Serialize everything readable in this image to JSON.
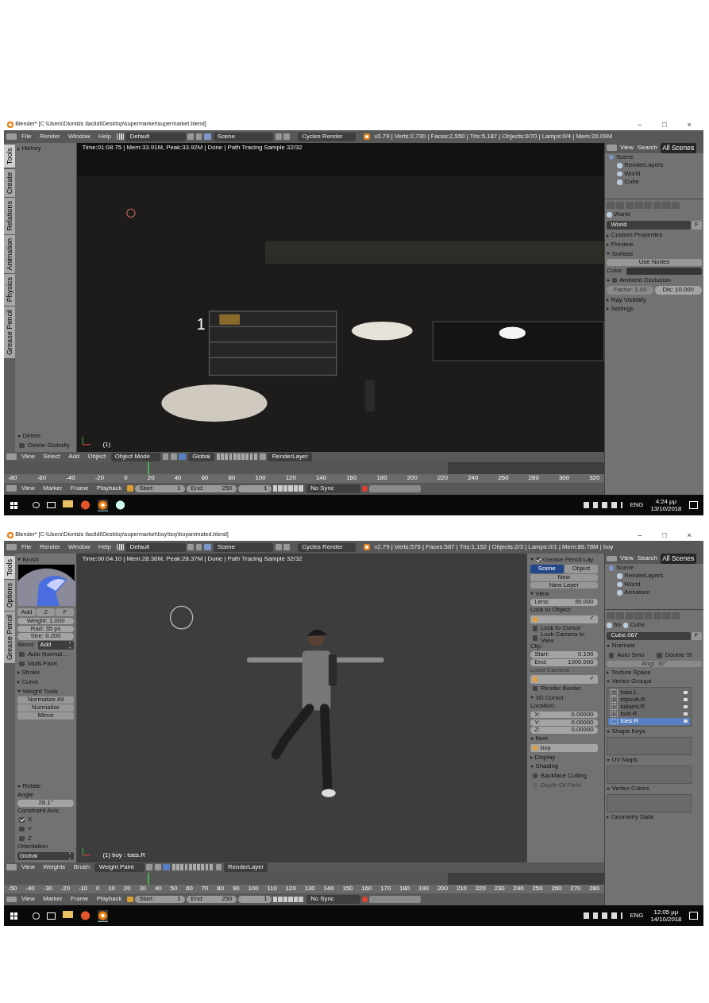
{
  "shots": [
    {
      "title": "Blender* [C:\\Users\\Dionisis Ilaclidi\\Desktop\\supermarket\\supermarket.blend]",
      "window_controls": [
        "–",
        "□",
        "×"
      ],
      "menus": [
        "File",
        "Render",
        "Window",
        "Help"
      ],
      "layout": "Default",
      "scene": "Scene",
      "engine": "Cycles Render",
      "stats": "v2.79 | Verts:2,730 | Faces:2,550 | Tris:5,187 | Objects:0/70 | Lamps:0/4 | Mem:20.09M",
      "tool_tabs": [
        {
          "label": "Tools",
          "selected": true
        },
        {
          "label": "Create",
          "selected": false
        },
        {
          "label": "Relations",
          "selected": false
        },
        {
          "label": "Animation",
          "selected": false
        },
        {
          "label": "Physics",
          "selected": false
        },
        {
          "label": "Grease Pencil",
          "selected": false
        }
      ],
      "tool_panels": [
        {
          "kind": "panel",
          "label": "History",
          "expanded": false
        }
      ],
      "tool_panels_lower": [
        {
          "kind": "panel",
          "label": "Delete",
          "expanded": true
        },
        {
          "kind": "check",
          "label": "Delete Globally",
          "checked": false
        }
      ],
      "render_info": "Time:01:08.75 | Mem:33.91M, Peak:33.92M | Done | Path Tracing Sample 32/32",
      "viewport": {
        "kind": "render",
        "marker": "1",
        "label": "(1)"
      },
      "viewport_header": {
        "menus": [
          "View",
          "Select",
          "Add",
          "Object"
        ],
        "mode": "Object Mode",
        "orientation": "Global",
        "layer": "RenderLayer"
      },
      "ruler": [
        "-80",
        "-60",
        "-40",
        "-20",
        "0",
        "20",
        "40",
        "60",
        "80",
        "100",
        "120",
        "140",
        "160",
        "180",
        "200",
        "220",
        "240",
        "260",
        "280",
        "300",
        "320"
      ],
      "timeline": {
        "menus": [
          "View",
          "Marker",
          "Frame",
          "Playback"
        ],
        "start_label": "Start:",
        "start": "1",
        "end_label": "End:",
        "end": "250",
        "frame": "1",
        "sync": "No Sync"
      },
      "outliner": {
        "menus": [
          "View",
          "Search"
        ],
        "filter": "All Scenes",
        "tree": [
          {
            "label": "Scene",
            "children": [
              {
                "label": "RenderLayers"
              },
              {
                "label": "World"
              },
              {
                "label": "Cube"
              }
            ]
          }
        ]
      },
      "properties": {
        "path": [
          "World"
        ],
        "datablock": "World",
        "datablock_flag": "F",
        "widgets": [
          {
            "kind": "panel",
            "label": "Custom Properties",
            "expanded": false
          },
          {
            "kind": "panel",
            "label": "Preview",
            "expanded": false
          },
          {
            "kind": "panel",
            "label": "Surface",
            "expanded": true
          },
          {
            "kind": "button",
            "label": "Use Nodes"
          },
          {
            "kind": "color",
            "label": "Color:"
          },
          {
            "kind": "panel",
            "label": "Ambient Occlusion",
            "expanded": true,
            "checked": false
          },
          {
            "kind": "pair",
            "items": [
              {
                "kind": "field",
                "label": "Factor: 1.00",
                "disabled": true
              },
              {
                "kind": "field",
                "label": "Dis: 10.000",
                "disabled": false
              }
            ]
          },
          {
            "kind": "panel",
            "label": "Ray Visibility",
            "expanded": false
          },
          {
            "kind": "panel",
            "label": "Settings",
            "expanded": false
          }
        ]
      },
      "taskbar": {
        "apps": [
          {
            "kind": "folder",
            "selected": false
          },
          {
            "kind": "browser",
            "selected": false
          },
          {
            "kind": "blender",
            "selected": true
          },
          {
            "kind": "program",
            "selected": false
          }
        ],
        "lang": "ENG",
        "time": "4:24 μμ",
        "date": "13/10/2018"
      }
    },
    {
      "title": "Blender* [C:\\Users\\Dionisis Ilaclidi\\Desktop\\supermarket\\boy\\boy\\boyanimated.blend]",
      "window_controls": [
        "–",
        "□",
        "×"
      ],
      "menus": [
        "File",
        "Render",
        "Window",
        "Help"
      ],
      "layout": "Default",
      "scene": "Scene",
      "engine": "Cycles Render",
      "stats": "v2.79 | Verts:575 | Faces:587 | Tris:1,152 | Objects:2/3 | Lamps:0/1 | Mem:86.78M | boy",
      "tool_tabs": [
        {
          "label": "Tools",
          "selected": true
        },
        {
          "label": "Options",
          "selected": false
        },
        {
          "label": "Grease Pencil",
          "selected": false
        }
      ],
      "tool_panels": [
        {
          "kind": "panel",
          "label": "Brush",
          "expanded": true
        },
        {
          "kind": "brush"
        },
        {
          "kind": "pair",
          "items": [
            {
              "kind": "button",
              "label": "Add"
            },
            {
              "kind": "button",
              "label": "2"
            },
            {
              "kind": "button",
              "label": "F"
            }
          ]
        },
        {
          "kind": "field",
          "label": "Weight: 1.000"
        },
        {
          "kind": "field",
          "label": "Rad: 35 px"
        },
        {
          "kind": "field",
          "label": "Stre: 0.200"
        },
        {
          "kind": "select",
          "label": "Blend:",
          "value": "Add"
        },
        {
          "kind": "check",
          "label": "Auto Normal...",
          "checked": false
        },
        {
          "kind": "check",
          "label": "Multi-Paint",
          "checked": false
        },
        {
          "kind": "panel",
          "label": "Stroke",
          "expanded": false
        },
        {
          "kind": "panel",
          "label": "Curve",
          "expanded": false
        },
        {
          "kind": "panel",
          "label": "Weight Tools",
          "expanded": true
        },
        {
          "kind": "button",
          "label": "Normalize All"
        },
        {
          "kind": "button",
          "label": "Normalize"
        },
        {
          "kind": "button",
          "label": "Mirror"
        }
      ],
      "tool_panels_lower": [
        {
          "kind": "panel",
          "label": "Rotate",
          "expanded": true
        },
        {
          "kind": "label",
          "label": "Angle"
        },
        {
          "kind": "field",
          "label": "28.1°"
        },
        {
          "kind": "label",
          "label": "Constraint Axis:"
        },
        {
          "kind": "check",
          "label": "X",
          "checked": true
        },
        {
          "kind": "check",
          "label": "Y",
          "checked": false
        },
        {
          "kind": "check",
          "label": "Z",
          "checked": false
        },
        {
          "kind": "label",
          "label": "Orientation"
        },
        {
          "kind": "select",
          "value": "Global"
        }
      ],
      "render_info": "Time:00:04.10 | Mem:28.36M, Peak:28.37M | Done | Path Tracing Sample 32/32",
      "viewport": {
        "kind": "character",
        "label": "(1) boy : toes.R"
      },
      "npanel": [
        {
          "kind": "panel",
          "label": "Grease Pencil Lay",
          "expanded": true,
          "checked": true
        },
        {
          "kind": "pair",
          "items": [
            {
              "kind": "button",
              "label": "Scene",
              "selected": true
            },
            {
              "kind": "button",
              "label": "Object",
              "selected": false
            }
          ]
        },
        {
          "kind": "button",
          "label": "New"
        },
        {
          "kind": "button",
          "label": "New Layer"
        },
        {
          "kind": "panel",
          "label": "View",
          "expanded": true
        },
        {
          "kind": "field",
          "label": "Lens:",
          "value": "35.000"
        },
        {
          "kind": "label",
          "label": "Lock to Object:"
        },
        {
          "kind": "picker"
        },
        {
          "kind": "check",
          "label": "Lock to Cursor",
          "checked": false
        },
        {
          "kind": "check",
          "label": "Lock Camera to View",
          "checked": false
        },
        {
          "kind": "label",
          "label": "Clip:"
        },
        {
          "kind": "field",
          "label": "Start:",
          "value": "0.100"
        },
        {
          "kind": "field",
          "label": "End:",
          "value": "1000.000"
        },
        {
          "kind": "label",
          "label": "Local Camera",
          "disabled": true
        },
        {
          "kind": "picker"
        },
        {
          "kind": "check",
          "label": "Render Border",
          "checked": false
        },
        {
          "kind": "panel",
          "label": "3D Cursor",
          "expanded": true
        },
        {
          "kind": "label",
          "label": "Location:"
        },
        {
          "kind": "field",
          "label": "X:",
          "value": "0.00000"
        },
        {
          "kind": "field",
          "label": "Y:",
          "value": "0.00000"
        },
        {
          "kind": "field",
          "label": "Z:",
          "value": "0.00000"
        },
        {
          "kind": "panel",
          "label": "Item",
          "expanded": true
        },
        {
          "kind": "picker",
          "value": "boy"
        },
        {
          "kind": "panel",
          "label": "Display",
          "expanded": false
        },
        {
          "kind": "panel",
          "label": "Shading",
          "expanded": true
        },
        {
          "kind": "check",
          "label": "Backface Culling",
          "checked": false
        },
        {
          "kind": "check",
          "label": "Depth Of Field",
          "checked": false,
          "disabled": true
        }
      ],
      "viewport_header": {
        "menus": [
          "View",
          "Weights",
          "Brush"
        ],
        "mode": "Weight Paint",
        "layer": "RenderLayer"
      },
      "ruler": [
        "-50",
        "-40",
        "-30",
        "-20",
        "-10",
        "0",
        "10",
        "20",
        "30",
        "40",
        "50",
        "60",
        "70",
        "80",
        "90",
        "100",
        "110",
        "120",
        "130",
        "140",
        "150",
        "160",
        "170",
        "180",
        "190",
        "200",
        "210",
        "220",
        "230",
        "240",
        "250",
        "260",
        "270",
        "280"
      ],
      "timeline": {
        "menus": [
          "View",
          "Marker",
          "Frame",
          "Playback"
        ],
        "start_label": "Start:",
        "start": "1",
        "end_label": "End:",
        "end": "250",
        "frame": "1",
        "sync": "No Sync"
      },
      "outliner": {
        "menus": [
          "View",
          "Search"
        ],
        "filter": "All Scenes",
        "tree": [
          {
            "label": "Scene",
            "children": [
              {
                "label": "RenderLayers"
              },
              {
                "label": "World"
              },
              {
                "label": "Armature"
              }
            ]
          }
        ]
      },
      "properties": {
        "path": [
          "bo",
          "Cube"
        ],
        "datablock": "Cube.067",
        "datablock_flag": "F",
        "widgets": [
          {
            "kind": "panel",
            "label": "Normals",
            "expanded": true
          },
          {
            "kind": "pair",
            "items": [
              {
                "kind": "check",
                "label": "Auto Smo",
                "checked": false
              },
              {
                "kind": "check",
                "label": "Double Si",
                "checked": false
              }
            ]
          },
          {
            "kind": "field",
            "label": "Angl: 30°",
            "disabled": true
          },
          {
            "kind": "panel",
            "label": "Texture Space",
            "expanded": false
          },
          {
            "kind": "panel",
            "label": "Vertex Groups",
            "expanded": true
          },
          {
            "kind": "list",
            "items": [
              {
                "label": "toes.L",
                "selected": false
              },
              {
                "label": "mpouti.R",
                "selected": false
              },
              {
                "label": "kalami.R",
                "selected": false
              },
              {
                "label": "foot.R",
                "selected": false
              },
              {
                "label": "toes.R",
                "selected": true
              }
            ]
          },
          {
            "kind": "panel",
            "label": "Shape Keys",
            "expanded": true
          },
          {
            "kind": "emptylist"
          },
          {
            "kind": "panel",
            "label": "UV Maps",
            "expanded": true
          },
          {
            "kind": "emptylist"
          },
          {
            "kind": "panel",
            "label": "Vertex Colors",
            "expanded": true
          },
          {
            "kind": "emptylist"
          },
          {
            "kind": "panel",
            "label": "Geometry Data",
            "expanded": false
          }
        ]
      },
      "taskbar": {
        "apps": [
          {
            "kind": "folder",
            "selected": false
          },
          {
            "kind": "browser",
            "selected": false
          },
          {
            "kind": "blender",
            "selected": true
          }
        ],
        "lang": "ENG",
        "time": "12:05 μμ",
        "date": "14/10/2018"
      }
    }
  ]
}
